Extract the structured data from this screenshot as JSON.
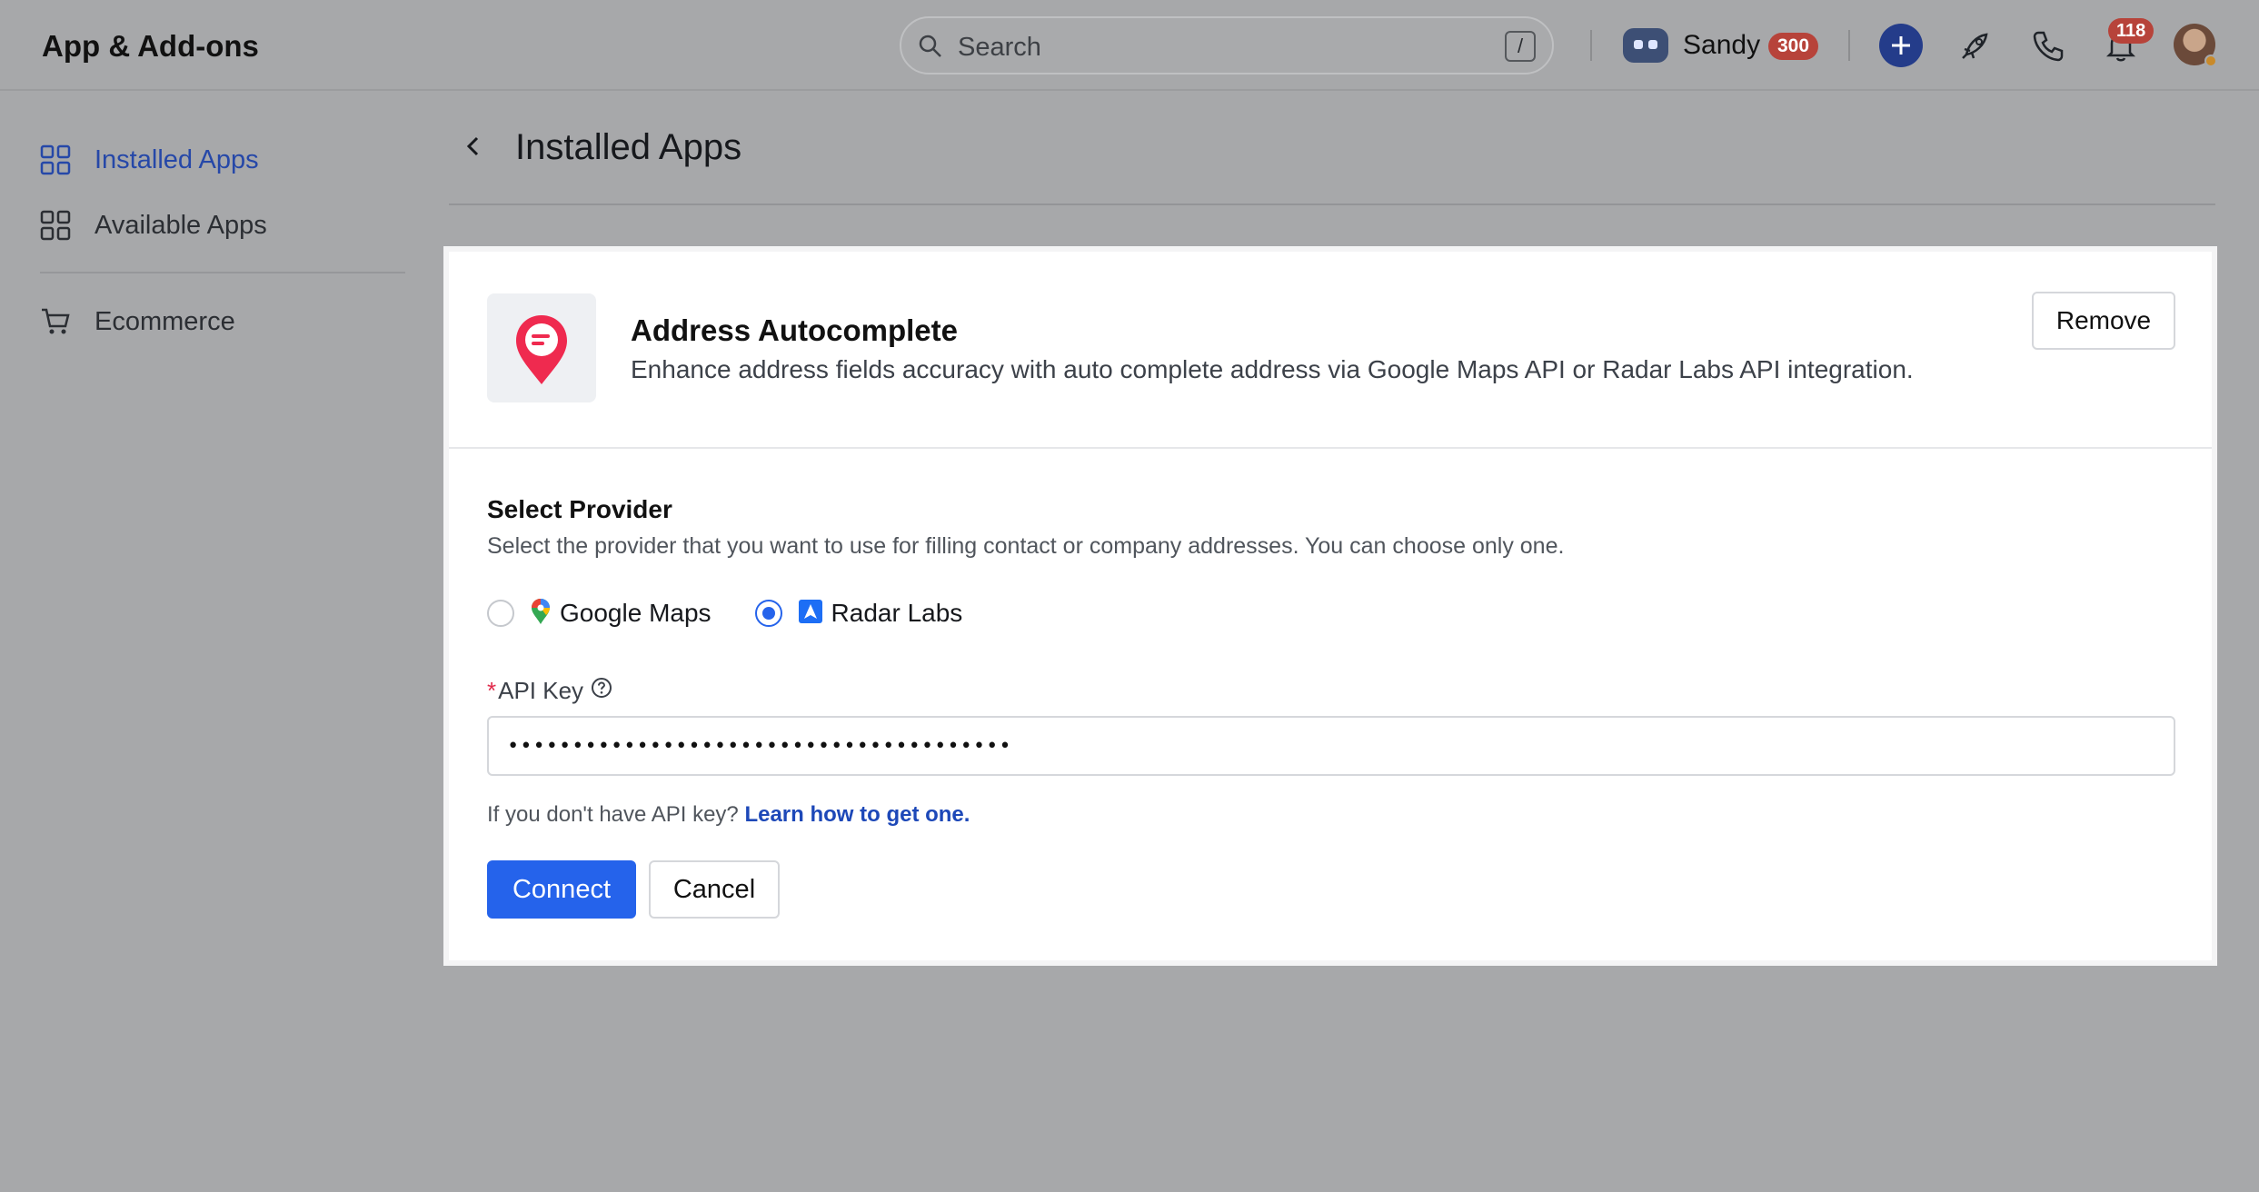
{
  "header": {
    "app_title": "App & Add-ons",
    "search": {
      "placeholder": "Search",
      "shortcut": "/"
    },
    "user": {
      "name": "Sandy",
      "points": "300"
    },
    "notifications_count": "118",
    "icons": [
      "bot-icon",
      "plus-icon",
      "rocket-icon",
      "phone-icon",
      "bell-icon",
      "avatar"
    ]
  },
  "sidebar": {
    "items": [
      {
        "label": "Installed Apps",
        "icon": "grid-icon",
        "active": true
      },
      {
        "label": "Available Apps",
        "icon": "grid-icon",
        "active": false
      },
      {
        "label": "Ecommerce",
        "icon": "cart-icon",
        "active": false
      }
    ]
  },
  "page": {
    "title": "Installed Apps"
  },
  "app": {
    "name": "Address Autocomplete",
    "description": "Enhance address fields accuracy with auto complete address via Google Maps API or Radar Labs API integration.",
    "remove_label": "Remove"
  },
  "provider": {
    "title": "Select Provider",
    "description": "Select the provider that you want to use for filling contact or company addresses. You can choose only one.",
    "options": [
      {
        "label": "Google Maps",
        "checked": false
      },
      {
        "label": "Radar Labs",
        "checked": true
      }
    ]
  },
  "api_key": {
    "required_mark": "*",
    "label": "API Key",
    "value": "•••••••••••••••••••••••••••••••••••••••",
    "hint_text": "If you don't have API key? ",
    "hint_link": "Learn how to get one."
  },
  "actions": {
    "connect_label": "Connect",
    "cancel_label": "Cancel"
  },
  "colors": {
    "primary": "#2563eb",
    "link": "#1d48b8",
    "badge": "#b7433a",
    "required": "#e0294a",
    "overlay": "#a7a8aa"
  }
}
